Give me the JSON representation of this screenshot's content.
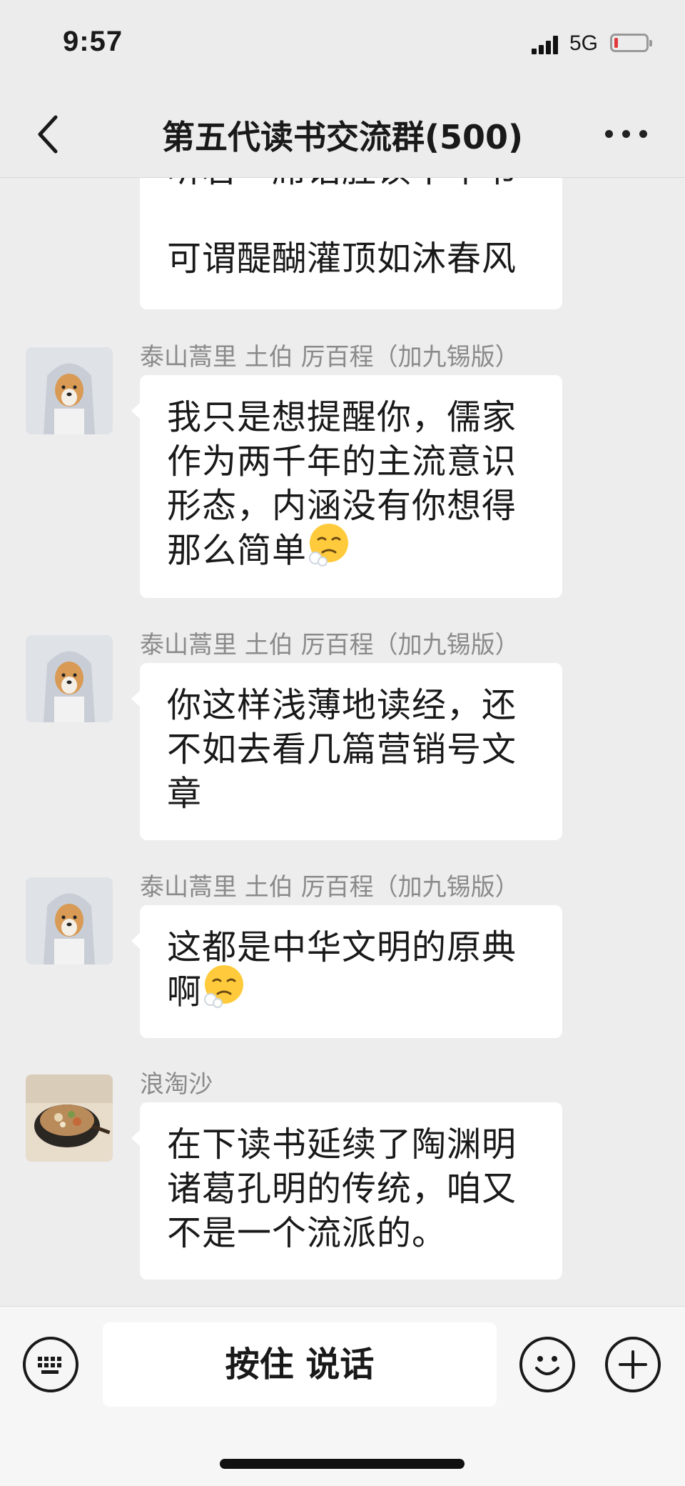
{
  "status_bar": {
    "time": "9:57",
    "network": "5G",
    "battery_color": "#e03a3a"
  },
  "nav": {
    "title": "第五代读书交流群(500)",
    "back_icon": "chevron-left-icon",
    "more_icon": "ellipsis-icon"
  },
  "messages": [
    {
      "sender": "",
      "lines": [
        "听君一席话胜读十年书",
        "",
        "可谓醍醐灌顶如沐春风"
      ]
    },
    {
      "sender": "泰山蒿里 土伯 厉百程（加九锡版）",
      "lines": [
        "我只是想提醒你，儒家",
        "作为两千年的主流意识",
        "形态，内涵没有你想得",
        "那么简单"
      ],
      "emoji": "sigh-emoji"
    },
    {
      "sender": "泰山蒿里 土伯 厉百程（加九锡版）",
      "lines": [
        "你这样浅薄地读经，还",
        "不如去看几篇营销号文",
        "章"
      ]
    },
    {
      "sender": "泰山蒿里 土伯 厉百程（加九锡版）",
      "lines": [
        "这都是中华文明的原典",
        "啊"
      ],
      "emoji": "sigh-emoji"
    },
    {
      "sender": "浪淘沙",
      "lines": [
        "在下读书延续了陶渊明",
        "诸葛孔明的传统，咱又",
        "不是一个流派的。"
      ]
    }
  ],
  "input_bar": {
    "hold_to_talk_label": "按住 说话",
    "keyboard_icon": "keyboard-icon",
    "emoji_icon": "smiley-icon",
    "plus_icon": "plus-icon"
  }
}
